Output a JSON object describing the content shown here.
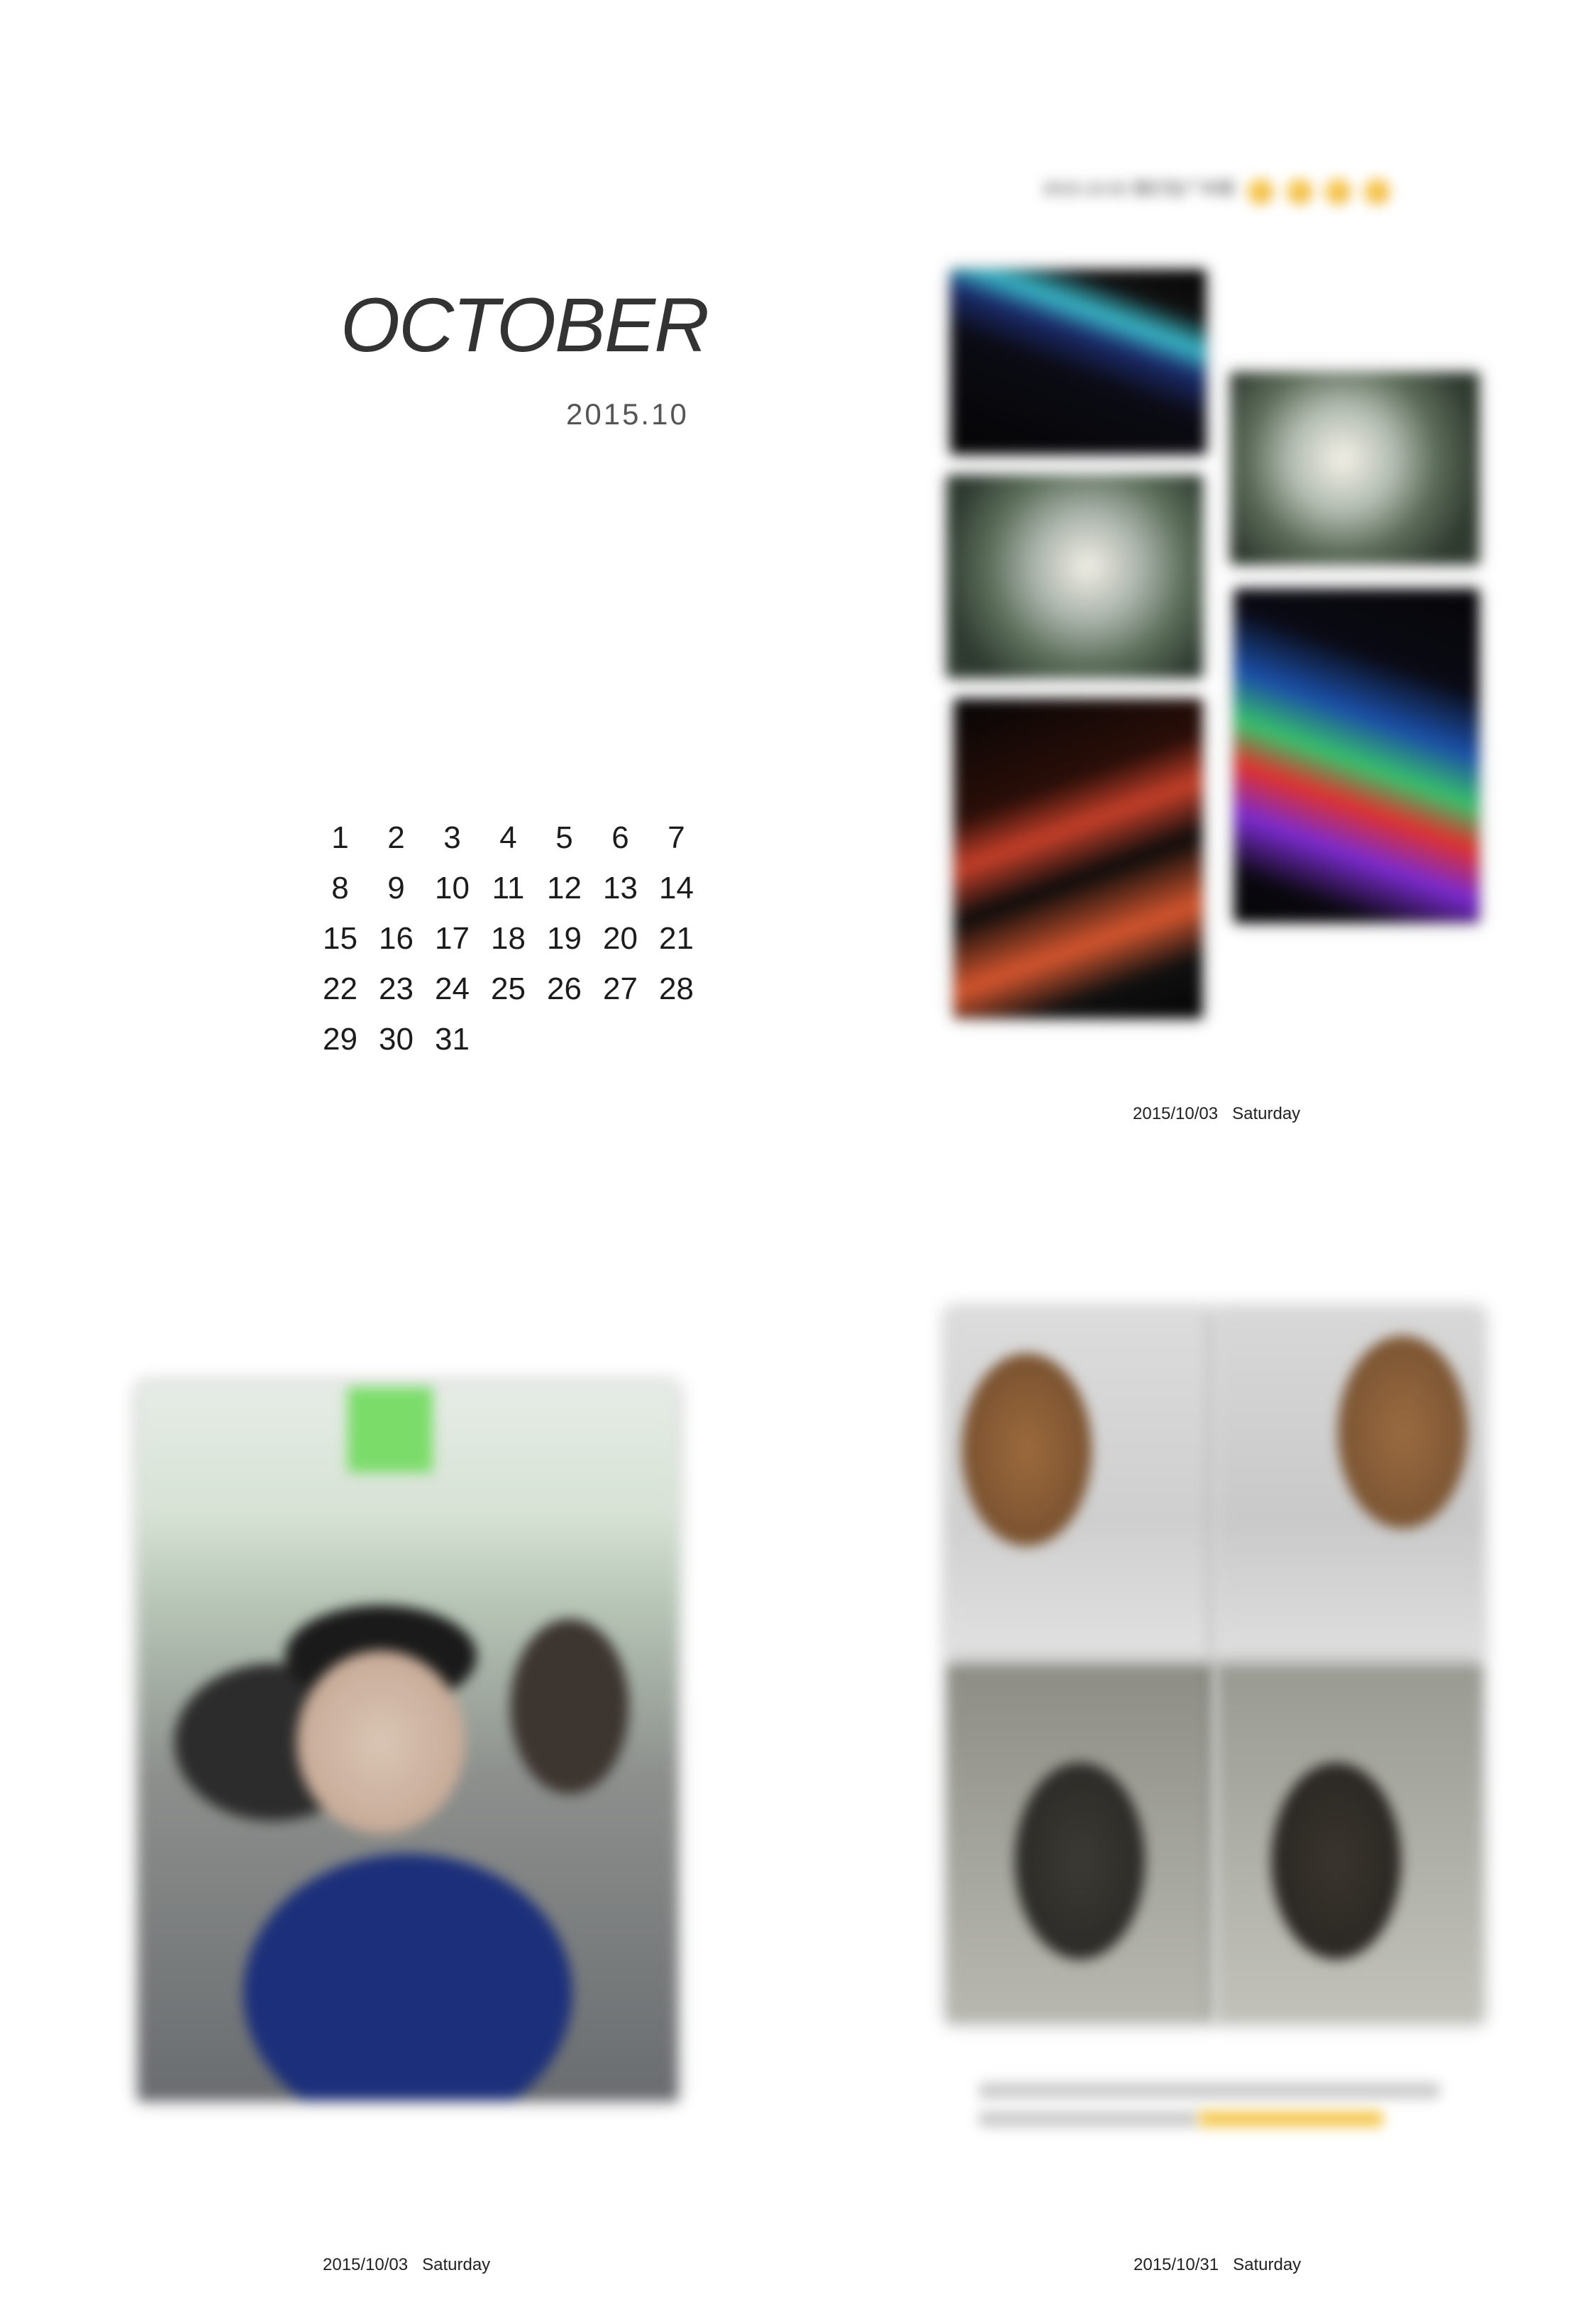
{
  "month": {
    "title": "OCTOBER",
    "subtitle": "2015.10"
  },
  "calendar": {
    "days": [
      "1",
      "2",
      "3",
      "4",
      "5",
      "6",
      "7",
      "8",
      "9",
      "10",
      "11",
      "12",
      "13",
      "14",
      "15",
      "16",
      "17",
      "18",
      "19",
      "20",
      "21",
      "22",
      "23",
      "24",
      "25",
      "26",
      "27",
      "28",
      "29",
      "30",
      "31"
    ]
  },
  "note": {
    "text": "2015.10.02 我们在广州塔",
    "emoji_icon": "smile-emoji-icon",
    "emoji_count": 4
  },
  "captions": {
    "top_right": "2015/10/03   Saturday",
    "bottom_left": "2015/10/03   Saturday",
    "bottom_right": "2015/10/31   Saturday"
  },
  "colors": {
    "text": "#222222",
    "accent_yellow": "#f4c64b",
    "background": "#ffffff"
  }
}
